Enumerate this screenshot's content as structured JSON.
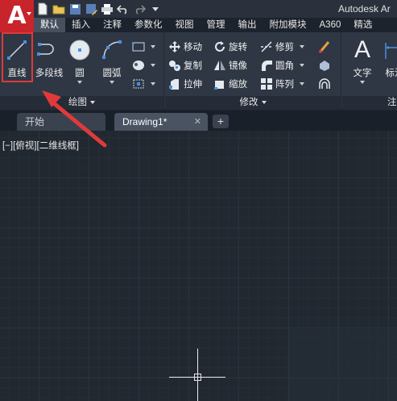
{
  "title_bar": {
    "app_title": "Autodesk Ar",
    "app_menu_icon": "autocad-logo-icon",
    "quick_access_icons": [
      "new-icon",
      "open-icon",
      "save-icon",
      "save-as-icon",
      "print-icon",
      "undo-icon",
      "redo-icon",
      "customize-icon"
    ]
  },
  "ribbon_tabs": [
    "默认",
    "插入",
    "注释",
    "参数化",
    "视图",
    "管理",
    "输出",
    "附加模块",
    "A360",
    "精选"
  ],
  "ribbon": {
    "draw_panel": {
      "title": "绘图",
      "big_buttons": [
        {
          "label": "直线",
          "icon": "line-icon"
        },
        {
          "label": "多段线",
          "icon": "polyline-icon"
        },
        {
          "label": "圆",
          "icon": "circle-icon"
        },
        {
          "label": "圆弧",
          "icon": "arc-icon"
        }
      ]
    },
    "modify_panel": {
      "title": "修改",
      "rows": [
        [
          {
            "label": "移动",
            "icon": "move-icon"
          },
          {
            "label": "旋转",
            "icon": "rotate-icon"
          },
          {
            "label": "修剪",
            "icon": "trim-icon"
          }
        ],
        [
          {
            "label": "复制",
            "icon": "copy-icon"
          },
          {
            "label": "镜像",
            "icon": "mirror-icon"
          },
          {
            "label": "圆角",
            "icon": "fillet-icon"
          }
        ],
        [
          {
            "label": "拉伸",
            "icon": "stretch-icon"
          },
          {
            "label": "缩放",
            "icon": "scale-icon"
          },
          {
            "label": "阵列",
            "icon": "array-icon"
          }
        ]
      ]
    },
    "annotation_panel": {
      "title": "注",
      "big_buttons": [
        {
          "label": "文字",
          "icon": "text-icon"
        },
        {
          "label": "标注",
          "icon": "dimension-icon"
        }
      ]
    }
  },
  "file_tabs": [
    {
      "label": "开始",
      "active": false
    },
    {
      "label": "Drawing1*",
      "active": true,
      "close": "✕"
    }
  ],
  "new_tab_label": "+",
  "viewport_label": "[−][俯视][二维线框]",
  "colors": {
    "app_button": "#c8242b",
    "highlight_border": "#e03a3a",
    "canvas_bg": "#212830",
    "ribbon_bg": "#2f3744"
  }
}
